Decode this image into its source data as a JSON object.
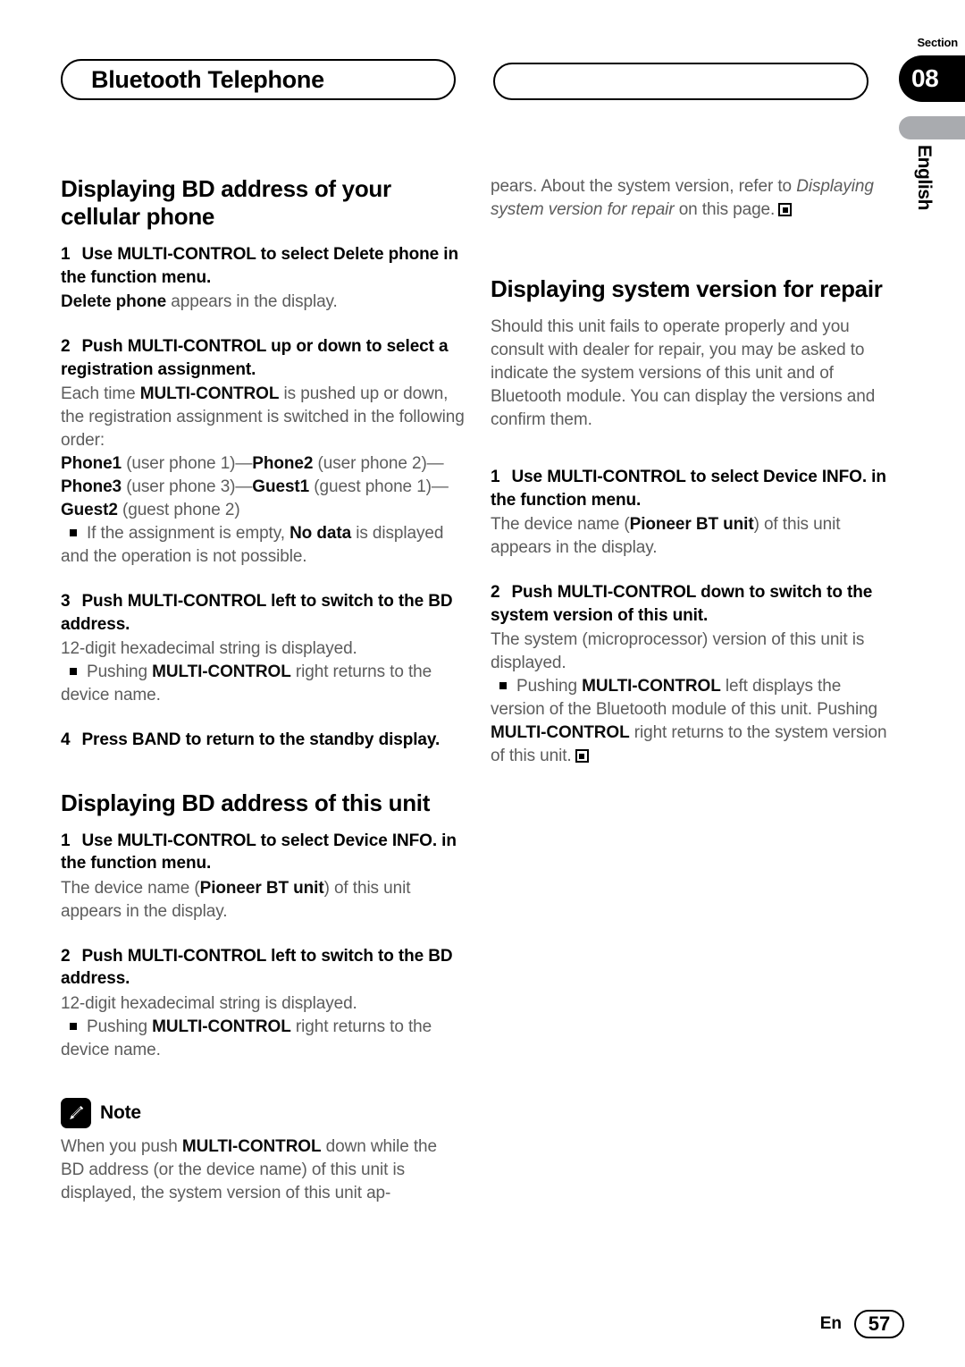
{
  "header": {
    "chapter_title": "Bluetooth Telephone",
    "section_label": "Section",
    "section_number": "08",
    "language_tab": "English"
  },
  "colors": {
    "section_tab_bg": "#000000",
    "language_tab_bg": "#a9abaf",
    "body_text": "#5c5c5c",
    "bold_text": "#0d0d0d"
  },
  "left_column": {
    "heading1": "Displaying BD address of your cellular phone",
    "step1": {
      "number": "1",
      "text": "Use MULTI-CONTROL to select Delete phone in the function menu.",
      "body_bold": "Delete phone",
      "body_rest": " appears in the display."
    },
    "step2": {
      "number": "2",
      "text": "Push MULTI-CONTROL up or down to select a registration assignment.",
      "body_a": "Each time ",
      "body_b1": "MULTI-CONTROL",
      "body_c": " is pushed up or down, the registration assignment is switched in the following order:",
      "order_p1": "Phone1",
      "order_t1": " (user phone 1)—",
      "order_p2": "Phone2",
      "order_t2": " (user phone 2)—",
      "order_p3": "Phone3",
      "order_t3": " (user phone 3)—",
      "order_g1": "Guest1",
      "order_t4": " (guest phone 1)—",
      "order_g2": "Guest2",
      "order_t5": " (guest phone 2)",
      "bullet_a": "If the assignment is empty, ",
      "bullet_b": "No data",
      "bullet_c": " is displayed and the operation is not possible."
    },
    "step3": {
      "number": "3",
      "text": "Push MULTI-CONTROL left to switch to the BD address.",
      "body": "12-digit hexadecimal string is displayed.",
      "bullet_a": "Pushing ",
      "bullet_b": "MULTI-CONTROL",
      "bullet_c": " right returns to the device name."
    },
    "step4": {
      "number": "4",
      "text": "Press BAND to return to the standby display."
    },
    "heading2": "Displaying BD address of this unit",
    "h2_step1": {
      "number": "1",
      "text": "Use MULTI-CONTROL to select Device INFO. in the function menu.",
      "body_a": "The device name (",
      "body_b": "Pioneer BT unit",
      "body_c": ") of this unit appears in the display."
    },
    "h2_step2": {
      "number": "2",
      "text": "Push MULTI-CONTROL left to switch to the BD address.",
      "body": "12-digit hexadecimal string is displayed.",
      "bullet_a": "Pushing ",
      "bullet_b": "MULTI-CONTROL",
      "bullet_c": " right returns to the device name."
    },
    "note": {
      "icon": "pencil-icon",
      "title": "Note",
      "text_a": "When you push ",
      "text_b": "MULTI-CONTROL",
      "text_c": " down while the BD address (or the device name) of this unit is displayed, the system version of this unit ap-"
    }
  },
  "right_column": {
    "continuation": {
      "text_a": "pears. About the system version, refer to ",
      "text_italic": "Displaying system version for repair",
      "text_b": " on this page."
    },
    "heading1": "Displaying system version for repair",
    "intro": "Should this unit fails to operate properly and you consult with dealer for repair, you may be asked to indicate the system versions of this unit and of Bluetooth module. You can display the versions and confirm them.",
    "step1": {
      "number": "1",
      "text": "Use MULTI-CONTROL to select Device INFO. in the function menu.",
      "body_a": "The device name (",
      "body_b": "Pioneer BT unit",
      "body_c": ") of this unit appears in the display."
    },
    "step2": {
      "number": "2",
      "text": "Push MULTI-CONTROL down to switch to the system version of this unit.",
      "body": "The system (microprocessor) version of this unit is displayed.",
      "bullet_a": "Pushing ",
      "bullet_b": "MULTI-CONTROL",
      "bullet_c": " left displays the version of the Bluetooth module of this unit. Pushing ",
      "bullet_d": "MULTI-CONTROL",
      "bullet_e": " right returns to the system version of this unit."
    }
  },
  "footer": {
    "language": "En",
    "page_number": "57"
  }
}
